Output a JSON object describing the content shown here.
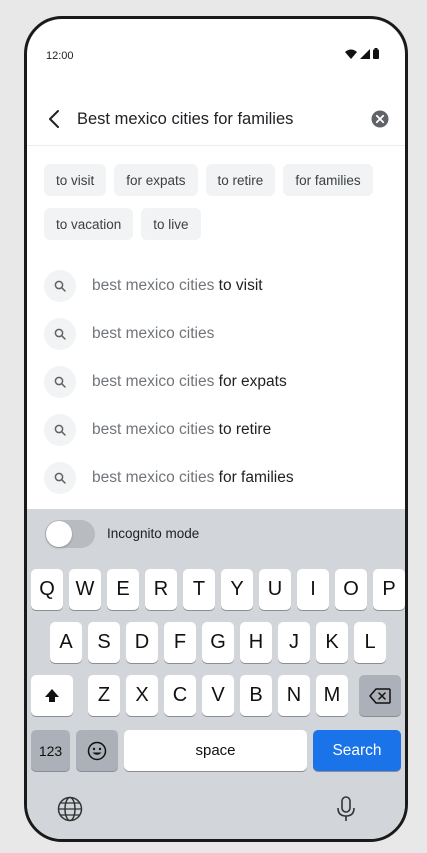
{
  "status_bar": {
    "time": "12:00"
  },
  "search": {
    "query": "Best mexico cities for families",
    "back_icon": "arrow-left-icon",
    "clear_icon": "clear-circle-icon"
  },
  "chips": [
    {
      "label": "to visit"
    },
    {
      "label": "for expats"
    },
    {
      "label": "to retire"
    },
    {
      "label": "for families"
    },
    {
      "label": "to vacation"
    },
    {
      "label": "to live"
    }
  ],
  "suggestions": [
    {
      "prefix": "best mexico cities ",
      "suffix": "to visit"
    },
    {
      "prefix": "best mexico cities",
      "suffix": ""
    },
    {
      "prefix": "best mexico cities ",
      "suffix": "for expats"
    },
    {
      "prefix": "best mexico cities ",
      "suffix": "to retire"
    },
    {
      "prefix": "best mexico cities ",
      "suffix": "for families"
    }
  ],
  "keyboard": {
    "incognito_label": "Incognito mode",
    "incognito_enabled": false,
    "row1": [
      "Q",
      "W",
      "E",
      "R",
      "T",
      "Y",
      "U",
      "I",
      "O",
      "P"
    ],
    "row2": [
      "A",
      "S",
      "D",
      "F",
      "G",
      "H",
      "J",
      "K",
      "L"
    ],
    "row3": [
      "Z",
      "X",
      "C",
      "V",
      "B",
      "N",
      "M"
    ],
    "numbers_label": "123",
    "space_label": "space",
    "search_label": "Search",
    "search_color": "#1a73e8"
  }
}
